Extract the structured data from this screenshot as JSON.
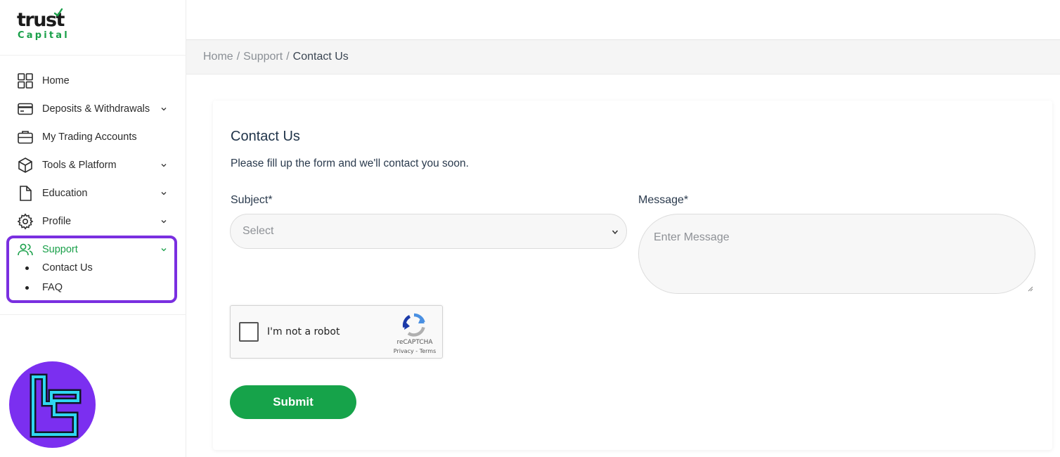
{
  "brand": {
    "logo_main": "trust",
    "logo_sub": "Capital",
    "accent_color": "#16a34a",
    "highlight_color": "#7a2fe0",
    "badge_color": "#7b2ff0"
  },
  "sidebar": {
    "items": [
      {
        "label": "Home",
        "icon": "grid-icon",
        "has_chevron": false
      },
      {
        "label": "Deposits & Withdrawals",
        "icon": "credit-card-icon",
        "has_chevron": true
      },
      {
        "label": "My Trading Accounts",
        "icon": "briefcase-icon",
        "has_chevron": false
      },
      {
        "label": "Tools & Platform",
        "icon": "cube-icon",
        "has_chevron": true
      },
      {
        "label": "Education",
        "icon": "file-icon",
        "has_chevron": true
      },
      {
        "label": "Profile",
        "icon": "gear-icon",
        "has_chevron": true
      }
    ],
    "support": {
      "label": "Support",
      "icon": "users-icon",
      "expanded": true,
      "children": [
        {
          "label": "Contact Us"
        },
        {
          "label": "FAQ"
        }
      ]
    }
  },
  "breadcrumb": {
    "items": [
      "Home",
      "Support"
    ],
    "current": "Contact Us"
  },
  "form": {
    "title": "Contact Us",
    "description": "Please fill up the form and we'll contact you soon.",
    "subject_label": "Subject*",
    "subject_value": "Select",
    "message_label": "Message*",
    "message_placeholder": "Enter Message",
    "captcha_text": "I'm not a robot",
    "captcha_brand": "reCAPTCHA",
    "captcha_links": "Privacy - Terms",
    "submit_label": "Submit"
  }
}
